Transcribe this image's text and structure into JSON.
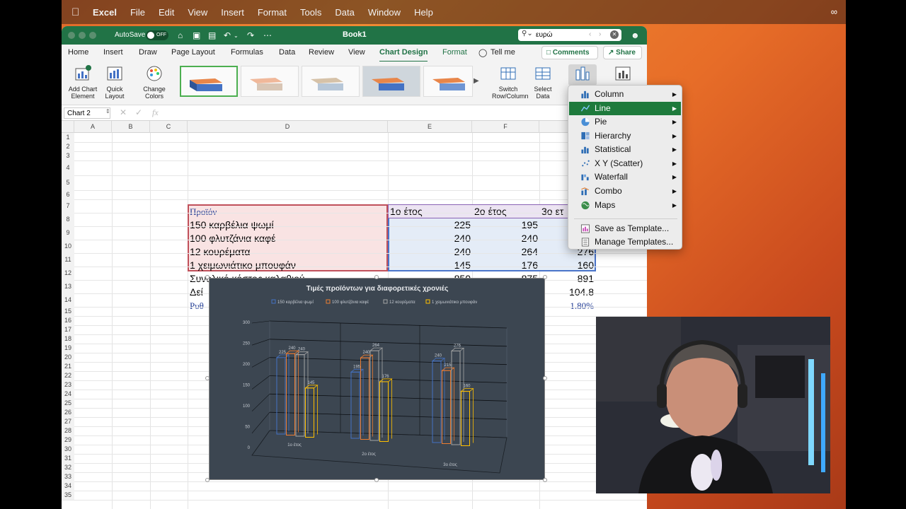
{
  "menubar": {
    "apple_icon": "apple-logo-icon",
    "app_name": "Excel",
    "items": [
      "File",
      "Edit",
      "View",
      "Insert",
      "Format",
      "Tools",
      "Data",
      "Window",
      "Help"
    ],
    "right_icon": "meta-icon"
  },
  "titlebar": {
    "autosave_label": "AutoSave",
    "autosave_state": "OFF",
    "doc_title": "Book1",
    "search_value": "ευρώ"
  },
  "tabs": [
    "Home",
    "Insert",
    "Draw",
    "Page Layout",
    "Formulas",
    "Data",
    "Review",
    "View",
    "Chart Design",
    "Format"
  ],
  "tell_me": "Tell me",
  "comments_label": "Comments",
  "share_label": "Share",
  "ribbon": {
    "add_chart_element": "Add Chart Element",
    "quick_layout": "Quick Layout",
    "change_colors": "Change Colors",
    "switch_row_col": "Switch Row/Column",
    "select_data": "Select Data"
  },
  "namebox": "Chart 2",
  "fx": "fx",
  "columns": [
    "A",
    "B",
    "C",
    "D",
    "E",
    "F",
    "G"
  ],
  "rows": [
    "1",
    "2",
    "3",
    "4",
    "5",
    "6",
    "7",
    "8",
    "9",
    "10",
    "11",
    "12",
    "13",
    "14",
    "15",
    "16",
    "17",
    "18",
    "19",
    "20",
    "21",
    "22",
    "23",
    "24",
    "25",
    "26",
    "27",
    "28",
    "29",
    "30",
    "31",
    "32",
    "33",
    "34",
    "35"
  ],
  "sheet": {
    "header": {
      "product": "Προϊόν",
      "y1": "1ο έτος",
      "y2": "2ο έτος",
      "y3": "3ο ετ"
    },
    "products": [
      {
        "name": "150 καρβέλια ψωμί",
        "y1": "225",
        "y2": "195"
      },
      {
        "name": "100 φλυτζάνια καφέ",
        "y1": "240",
        "y2": "240"
      },
      {
        "name": "12 κουρέματα",
        "y1": "240",
        "y2": "264",
        "y3": "276"
      },
      {
        "name": "1 χειμωνιάτικο μπουφάν",
        "y1": "145",
        "y2": "176",
        "y3": "160"
      }
    ],
    "row12_label": "Συνολικό κόστος καλαθιού",
    "row12_y1": "850",
    "row12_y2": "875",
    "row12_y3": "891",
    "row13_label": "Δεί",
    "row13_y3": "104.8",
    "row14_label": "Ρυθ",
    "row14_y3": "1.80%"
  },
  "chart_data": {
    "type": "bar",
    "title": "Τιμές προϊόντων για διαφορετικές χρονιές",
    "categories": [
      "1ο έτος",
      "2ο έτος",
      "3ο έτος"
    ],
    "series": [
      {
        "name": "150 καρβέλια ψωμί",
        "values": [
          225,
          195,
          240
        ],
        "color": "#4472c4"
      },
      {
        "name": "100 φλυτζάνια καφέ",
        "values": [
          240,
          240,
          215
        ],
        "color": "#ed7d31"
      },
      {
        "name": "12 κουρέματα",
        "values": [
          240,
          264,
          276
        ],
        "color": "#a5a5a5"
      },
      {
        "name": "1 χειμωνιάτικο μπουφάν",
        "values": [
          145,
          176,
          160
        ],
        "color": "#ffc000"
      }
    ],
    "ylim": [
      0,
      300
    ],
    "yticks": [
      "0",
      "50",
      "100",
      "150",
      "200",
      "250",
      "300"
    ],
    "grid": true,
    "legend": "top",
    "style": "3d-clustered-column"
  },
  "chart_menu": {
    "items": [
      {
        "label": "Column",
        "icon": "column-chart-icon",
        "sub": true
      },
      {
        "label": "Line",
        "icon": "line-chart-icon",
        "sub": true
      },
      {
        "label": "Pie",
        "icon": "pie-chart-icon",
        "sub": true
      },
      {
        "label": "Hierarchy",
        "icon": "hierarchy-chart-icon",
        "sub": true
      },
      {
        "label": "Statistical",
        "icon": "statistical-chart-icon",
        "sub": true
      },
      {
        "label": "X Y (Scatter)",
        "icon": "scatter-chart-icon",
        "sub": true
      },
      {
        "label": "Waterfall",
        "icon": "waterfall-chart-icon",
        "sub": true
      },
      {
        "label": "Combo",
        "icon": "combo-chart-icon",
        "sub": true
      },
      {
        "label": "Maps",
        "icon": "maps-icon",
        "sub": true
      }
    ],
    "template_items": [
      {
        "label": "Save as Template...",
        "icon": "save-template-icon"
      },
      {
        "label": "Manage Templates...",
        "icon": "manage-templates-icon"
      }
    ],
    "highlighted": "Line"
  },
  "colors": {
    "excel_green": "#217346",
    "menu_highlight": "#1e7a3c",
    "chart_bg": "#3c4651"
  }
}
